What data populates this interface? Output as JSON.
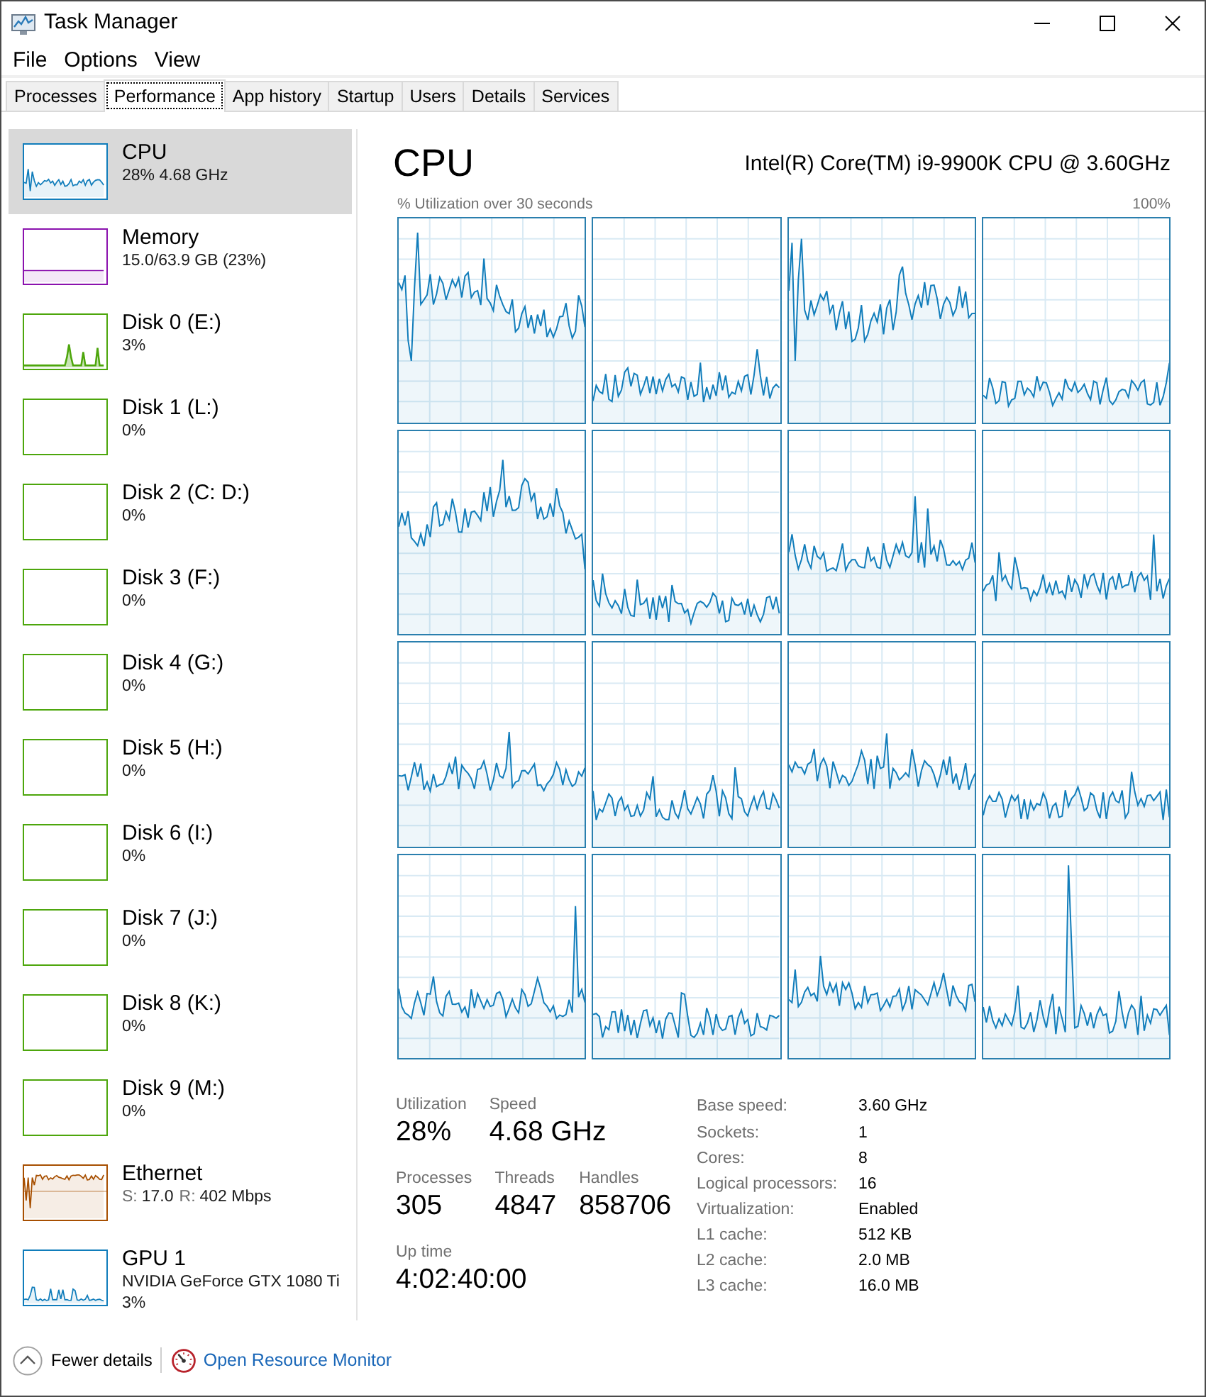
{
  "window": {
    "title": "Task Manager"
  },
  "menu": [
    "File",
    "Options",
    "View"
  ],
  "tabs": [
    {
      "label": "Processes",
      "selected": false
    },
    {
      "label": "Performance",
      "selected": true
    },
    {
      "label": "App history",
      "selected": false
    },
    {
      "label": "Startup",
      "selected": false
    },
    {
      "label": "Users",
      "selected": false
    },
    {
      "label": "Details",
      "selected": false
    },
    {
      "label": "Services",
      "selected": false
    }
  ],
  "sidebar": {
    "items": [
      {
        "kind": "cpu",
        "name": "CPU",
        "color": "#117dbb",
        "selected": true,
        "active": true,
        "details": [
          "28% 4.68 GHz"
        ]
      },
      {
        "kind": "memory",
        "name": "Memory",
        "color": "#8b12ae",
        "selected": false,
        "active": true,
        "details": [
          "15.0/63.9 GB (23%)"
        ]
      },
      {
        "kind": "disk",
        "name": "Disk 0 (E:)",
        "color": "#4da60c",
        "selected": false,
        "active": true,
        "details": [
          "3%"
        ]
      },
      {
        "kind": "disk",
        "name": "Disk 1 (L:)",
        "color": "#4da60c",
        "selected": false,
        "active": false,
        "details": [
          "0%"
        ]
      },
      {
        "kind": "disk",
        "name": "Disk 2 (C: D:)",
        "color": "#4da60c",
        "selected": false,
        "active": false,
        "details": [
          "0%"
        ]
      },
      {
        "kind": "disk",
        "name": "Disk 3 (F:)",
        "color": "#4da60c",
        "selected": false,
        "active": false,
        "details": [
          "0%"
        ]
      },
      {
        "kind": "disk",
        "name": "Disk 4 (G:)",
        "color": "#4da60c",
        "selected": false,
        "active": false,
        "details": [
          "0%"
        ]
      },
      {
        "kind": "disk",
        "name": "Disk 5 (H:)",
        "color": "#4da60c",
        "selected": false,
        "active": false,
        "details": [
          "0%"
        ]
      },
      {
        "kind": "disk",
        "name": "Disk 6 (I:)",
        "color": "#4da60c",
        "selected": false,
        "active": false,
        "details": [
          "0%"
        ]
      },
      {
        "kind": "disk",
        "name": "Disk 7 (J:)",
        "color": "#4da60c",
        "selected": false,
        "active": false,
        "details": [
          "0%"
        ]
      },
      {
        "kind": "disk",
        "name": "Disk 8 (K:)",
        "color": "#4da60c",
        "selected": false,
        "active": false,
        "details": [
          "0%"
        ]
      },
      {
        "kind": "disk",
        "name": "Disk 9 (M:)",
        "color": "#4da60c",
        "selected": false,
        "active": false,
        "details": [
          "0%"
        ]
      },
      {
        "kind": "ethernet",
        "name": "Ethernet",
        "color": "#a74f01",
        "selected": false,
        "active": true,
        "rates": [
          {
            "label": "S:",
            "value": "17.0"
          },
          {
            "label": "R:",
            "value": "402 Mbps"
          }
        ]
      },
      {
        "kind": "gpu",
        "name": "GPU 1",
        "color": "#117dbb",
        "selected": false,
        "active": true,
        "details": [
          "NVIDIA GeForce GTX 1080 Ti",
          "3%"
        ]
      }
    ]
  },
  "panel": {
    "title": "CPU",
    "model": "Intel(R) Core(TM) i9-9900K CPU @ 3.60GHz",
    "graph_caption": "% Utilization over 30 seconds",
    "graph_max": "100%",
    "stats": [
      [
        {
          "label": "Utilization",
          "value": "28%"
        },
        {
          "label": "Speed",
          "value": "4.68 GHz"
        }
      ],
      [
        {
          "label": "Processes",
          "value": "305"
        },
        {
          "label": "Threads",
          "value": "4847"
        },
        {
          "label": "Handles",
          "value": "858706"
        }
      ],
      [
        {
          "label": "Up time",
          "value": "4:02:40:00"
        }
      ]
    ],
    "specs": [
      {
        "label": "Base speed:",
        "value": "3.60 GHz"
      },
      {
        "label": "Sockets:",
        "value": "1"
      },
      {
        "label": "Cores:",
        "value": "8"
      },
      {
        "label": "Logical processors:",
        "value": "16"
      },
      {
        "label": "Virtualization:",
        "value": "Enabled"
      },
      {
        "label": "L1 cache:",
        "value": "512 KB"
      },
      {
        "label": "L2 cache:",
        "value": "2.0 MB"
      },
      {
        "label": "L3 cache:",
        "value": "16.0 MB"
      }
    ]
  },
  "footer": {
    "fewer_details": "Fewer details",
    "resource_monitor_link": "Open Resource Monitor"
  }
}
